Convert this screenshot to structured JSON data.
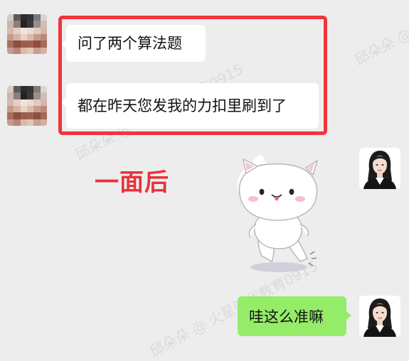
{
  "messages": [
    {
      "text": "问了两个算法题"
    },
    {
      "text": "都在昨天您发我的力扣里刷到了"
    }
  ],
  "caption": "一面后",
  "reply": "哇这么准嘛",
  "watermark": "邱朵朵 @ 火星时代教育0915",
  "colors": {
    "background": "#ededed",
    "highlight_border": "#f0343b",
    "caption": "#e8333a",
    "sent_bubble": "#95ec69",
    "received_bubble": "#ffffff"
  },
  "icons": [
    "pixelated-avatar",
    "cat-sticker",
    "profile-photo-avatar"
  ]
}
